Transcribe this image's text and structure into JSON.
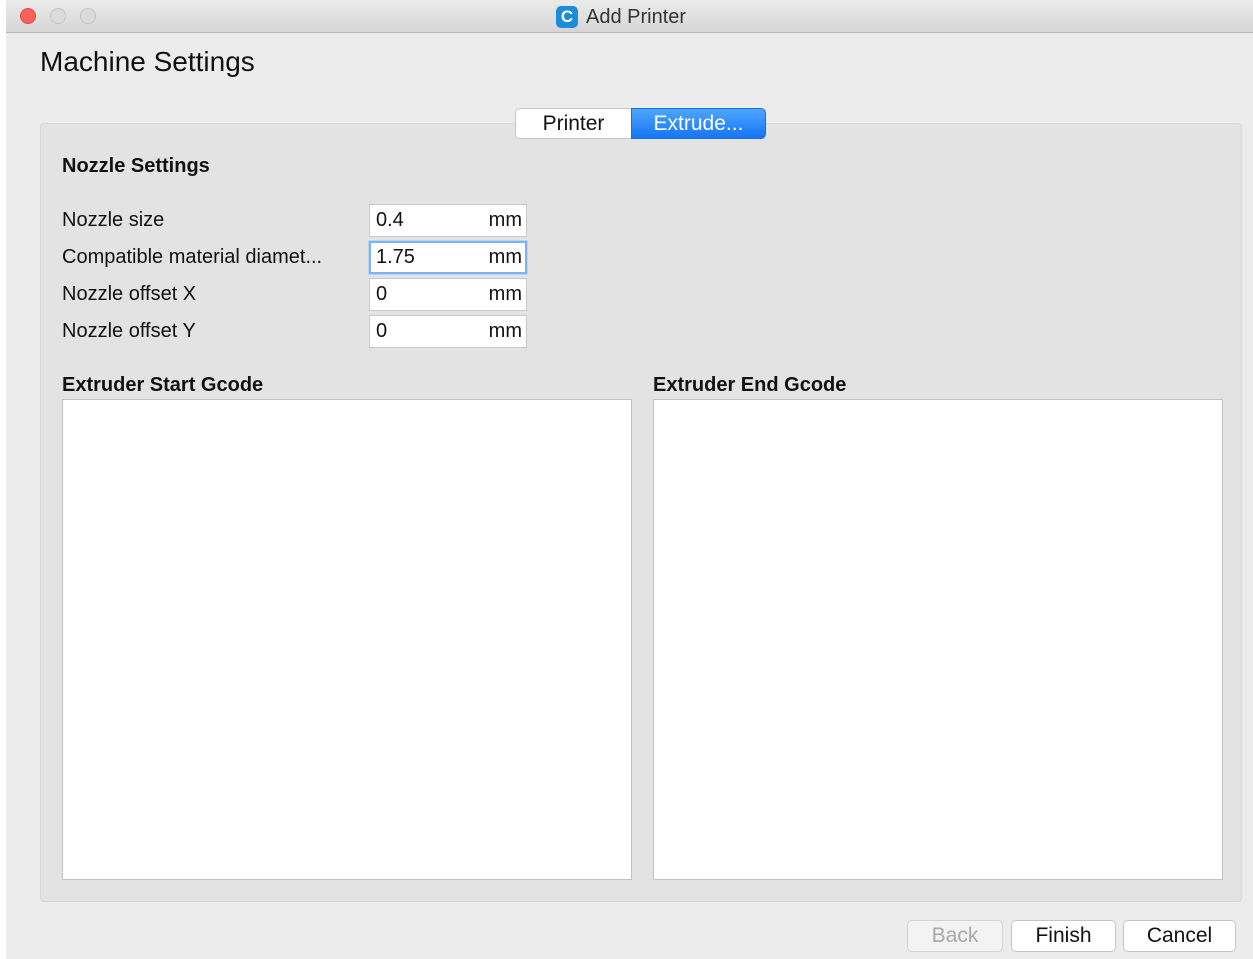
{
  "window": {
    "title": "Add Printer",
    "app_icon_glyph": "C",
    "app_icon_color": "#1c8dd9"
  },
  "page": {
    "heading": "Machine Settings"
  },
  "tabs": [
    {
      "label": "Printer",
      "active": false
    },
    {
      "label": "Extrude...",
      "active": true
    }
  ],
  "nozzle": {
    "section_title": "Nozzle Settings",
    "rows": [
      {
        "label": "Nozzle size",
        "value": "0.4",
        "unit": "mm"
      },
      {
        "label": "Compatible material diamet...",
        "value": "1.75",
        "unit": "mm"
      },
      {
        "label": "Nozzle offset X",
        "value": "0",
        "unit": "mm"
      },
      {
        "label": "Nozzle offset Y",
        "value": "0",
        "unit": "mm"
      }
    ]
  },
  "gcode": {
    "start_title": "Extruder Start Gcode",
    "end_title": "Extruder End Gcode",
    "start_value": "",
    "end_value": ""
  },
  "buttons": {
    "back": "Back",
    "finish": "Finish",
    "cancel": "Cancel"
  },
  "colors": {
    "accent": "#1575f5",
    "close_button": "#fc605c"
  }
}
